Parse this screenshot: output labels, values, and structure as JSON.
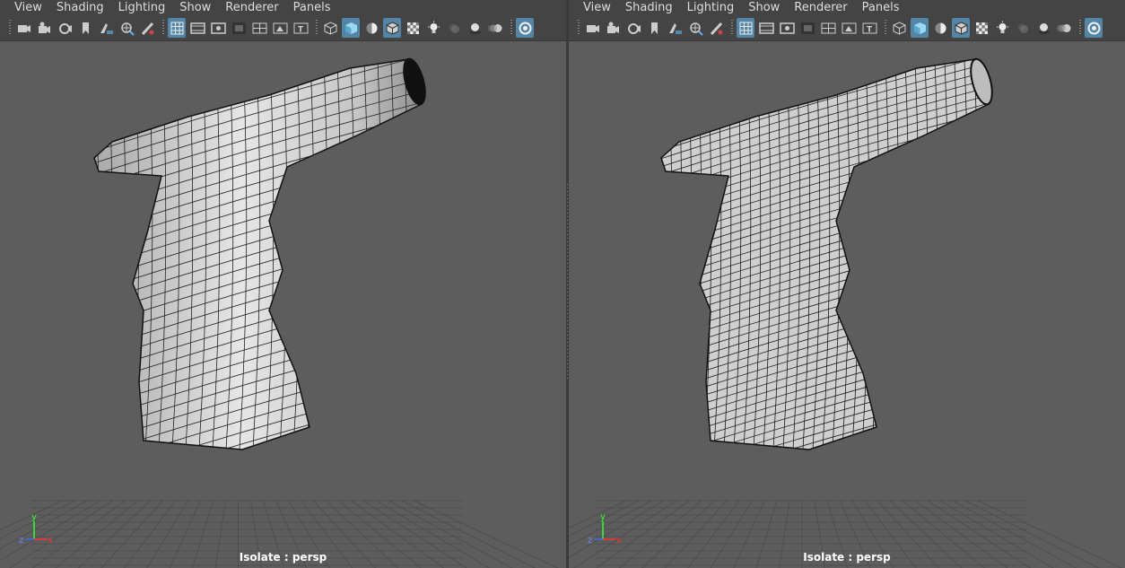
{
  "menus": [
    "View",
    "Shading",
    "Lighting",
    "Show",
    "Renderer",
    "Panels"
  ],
  "toolbar_icons": [
    {
      "name": "camera-icon",
      "active": false
    },
    {
      "name": "camera-attributes-icon",
      "active": false
    },
    {
      "name": "camera-tools-icon",
      "active": false
    },
    {
      "name": "bookmark-icon",
      "active": false
    },
    {
      "name": "image-plane-icon",
      "active": false
    },
    {
      "name": "two-d-pan-zoom-icon",
      "active": false
    },
    {
      "name": "grease-pencil-icon",
      "active": false
    },
    {
      "name": "grid-icon",
      "active": true
    },
    {
      "name": "film-gate-icon",
      "active": false
    },
    {
      "name": "resolution-gate-icon",
      "active": false
    },
    {
      "name": "gate-mask-icon",
      "active": false
    },
    {
      "name": "field-chart-icon",
      "active": false
    },
    {
      "name": "safe-action-icon",
      "active": false
    },
    {
      "name": "safe-title-icon",
      "active": false
    },
    {
      "name": "wireframe-icon",
      "active": false
    },
    {
      "name": "smooth-shade-icon",
      "active": true
    },
    {
      "name": "default-material-icon",
      "active": false
    },
    {
      "name": "wireframe-on-shaded-icon",
      "active": true
    },
    {
      "name": "x-ray-icon",
      "active": false
    },
    {
      "name": "lights-icon",
      "active": false
    },
    {
      "name": "shadows-icon",
      "active": false
    },
    {
      "name": "screen-space-ao-icon",
      "active": false
    },
    {
      "name": "motion-blur-icon",
      "active": false
    },
    {
      "name": "isolate-select-icon",
      "active": true
    }
  ],
  "viewports": [
    {
      "id": "left",
      "hud_label": "Isolate : persp",
      "mode": "shaded"
    },
    {
      "id": "right",
      "hud_label": "Isolate : persp",
      "mode": "wireframe"
    }
  ],
  "axis": {
    "x": "x",
    "y": "y",
    "z": "z"
  },
  "colors": {
    "accent": "#5285a6",
    "background": "#5d5d5d",
    "axis_x": "#ff3030",
    "axis_y": "#30ff30",
    "axis_z": "#3a6bff"
  }
}
